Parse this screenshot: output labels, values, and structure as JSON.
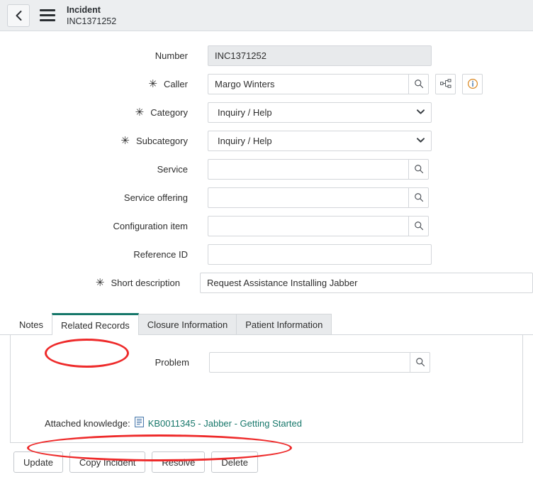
{
  "header": {
    "back_icon": "chevron-left-icon",
    "menu_icon": "hamburger-menu-icon",
    "title": "Incident",
    "subtitle": "INC1371252"
  },
  "form": {
    "fields": [
      {
        "label": "Number",
        "required": false,
        "type": "readonly-text",
        "value": "INC1371252",
        "placeholder": ""
      },
      {
        "label": "Caller",
        "required": true,
        "type": "reference",
        "value": "Margo Winters",
        "placeholder": "",
        "buttons": [
          "search-icon",
          "org-chart-icon",
          "info-icon"
        ]
      },
      {
        "label": "Category",
        "required": true,
        "type": "select",
        "value": "Inquiry / Help",
        "options": [
          "Inquiry / Help"
        ]
      },
      {
        "label": "Subcategory",
        "required": true,
        "type": "select",
        "value": "Inquiry / Help",
        "options": [
          "Inquiry / Help"
        ]
      },
      {
        "label": "Service",
        "required": false,
        "type": "reference",
        "value": "",
        "placeholder": "",
        "buttons": [
          "search-icon"
        ]
      },
      {
        "label": "Service offering",
        "required": false,
        "type": "reference",
        "value": "",
        "placeholder": "",
        "buttons": [
          "search-icon"
        ]
      },
      {
        "label": "Configuration item",
        "required": false,
        "type": "reference",
        "value": "",
        "placeholder": "",
        "buttons": [
          "search-icon"
        ]
      },
      {
        "label": "Reference ID",
        "required": false,
        "type": "text",
        "value": "",
        "placeholder": ""
      },
      {
        "label": "Short description",
        "required": true,
        "type": "text-wide",
        "value": "Request Assistance Installing Jabber",
        "placeholder": ""
      }
    ],
    "required_marker": "✳"
  },
  "tabs": {
    "items": [
      {
        "label": "Notes",
        "active": false
      },
      {
        "label": "Related Records",
        "active": true
      },
      {
        "label": "Closure Information",
        "active": false
      },
      {
        "label": "Patient Information",
        "active": false
      }
    ],
    "panel": {
      "problem_label": "Problem",
      "problem_value": "",
      "problem_button": "search-icon",
      "attached_knowledge_label": "Attached knowledge:",
      "attached_knowledge_icon": "knowledge-article-icon",
      "attached_knowledge_link": "KB0011345 - Jabber - Getting Started"
    }
  },
  "footer": {
    "buttons": [
      {
        "label": "Update"
      },
      {
        "label": "Copy Incident"
      },
      {
        "label": "Resolve"
      },
      {
        "label": "Delete"
      }
    ]
  },
  "annotations": {
    "color": "#ee2b2b",
    "shapes": [
      {
        "name": "related-records-tab-highlight"
      },
      {
        "name": "attached-knowledge-highlight"
      }
    ]
  }
}
